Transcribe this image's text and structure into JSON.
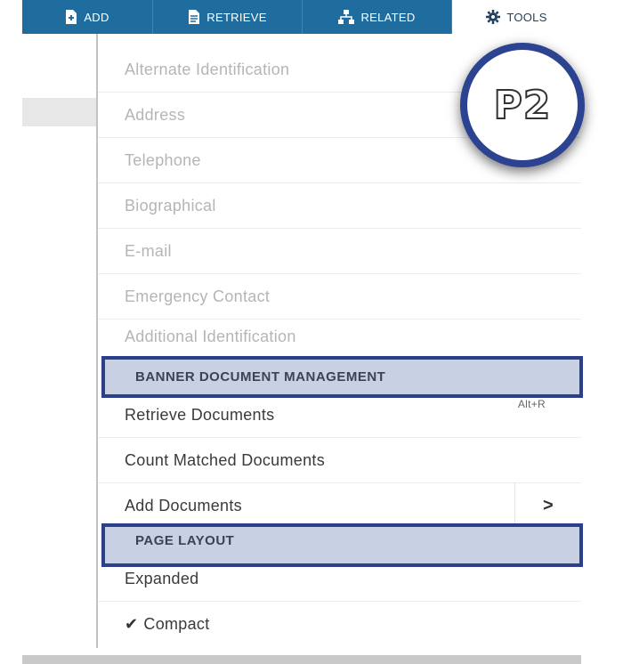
{
  "toolbar": {
    "add_label": "ADD",
    "retrieve_label": "RETRIEVE",
    "related_label": "RELATED",
    "tools_label": "TOOLS",
    "accent": "#1f6c9f"
  },
  "menu": {
    "items": [
      {
        "label": "Alternate Identification",
        "enabled": false
      },
      {
        "label": "Address",
        "enabled": false
      },
      {
        "label": "Telephone",
        "enabled": false
      },
      {
        "label": "Biographical",
        "enabled": false
      },
      {
        "label": "E-mail",
        "enabled": false
      },
      {
        "label": "Emergency Contact",
        "enabled": false
      },
      {
        "label": "Additional Identification",
        "enabled": false
      }
    ],
    "document_section": {
      "header": "BANNER DOCUMENT MANAGEMENT",
      "items": [
        {
          "label": "Retrieve Documents",
          "shortcut": "Alt+R"
        },
        {
          "label": "Count Matched Documents"
        },
        {
          "label": "Add Documents",
          "submenu_arrow": ">"
        }
      ]
    },
    "layout_section": {
      "header": "PAGE LAYOUT",
      "items": [
        {
          "label": "Expanded",
          "checked": false
        },
        {
          "label": "Compact",
          "checked": true
        }
      ]
    }
  },
  "badge": {
    "label": "P2",
    "color": "#2b4390"
  },
  "icons": [
    "add-icon",
    "retrieve-icon",
    "related-icon",
    "gear-icon",
    "checkmark-icon"
  ]
}
